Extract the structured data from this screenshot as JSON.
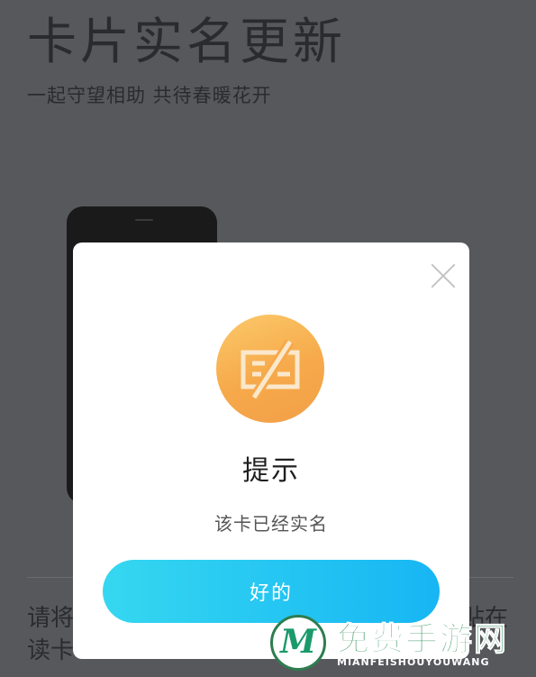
{
  "background": {
    "title": "卡片实名更新",
    "subtitle": "一起守望相助 共待春暖花开",
    "instruction_left": "请将",
    "instruction_right": "贴在",
    "instruction_bottom": "读卡"
  },
  "dialog": {
    "icon": "card-crossed-icon",
    "title": "提示",
    "message": "该卡已经实名",
    "ok_label": "好的",
    "close_icon": "close-icon"
  },
  "watermark": {
    "logo_letter": "M",
    "title": "免费手游网",
    "subtitle": "MIANFEISHOUYOUWANG"
  },
  "colors": {
    "overlay": "#57585c",
    "badge": "#f6a94a",
    "button": "#17b6f4",
    "watermark": "#2e8f5a"
  }
}
